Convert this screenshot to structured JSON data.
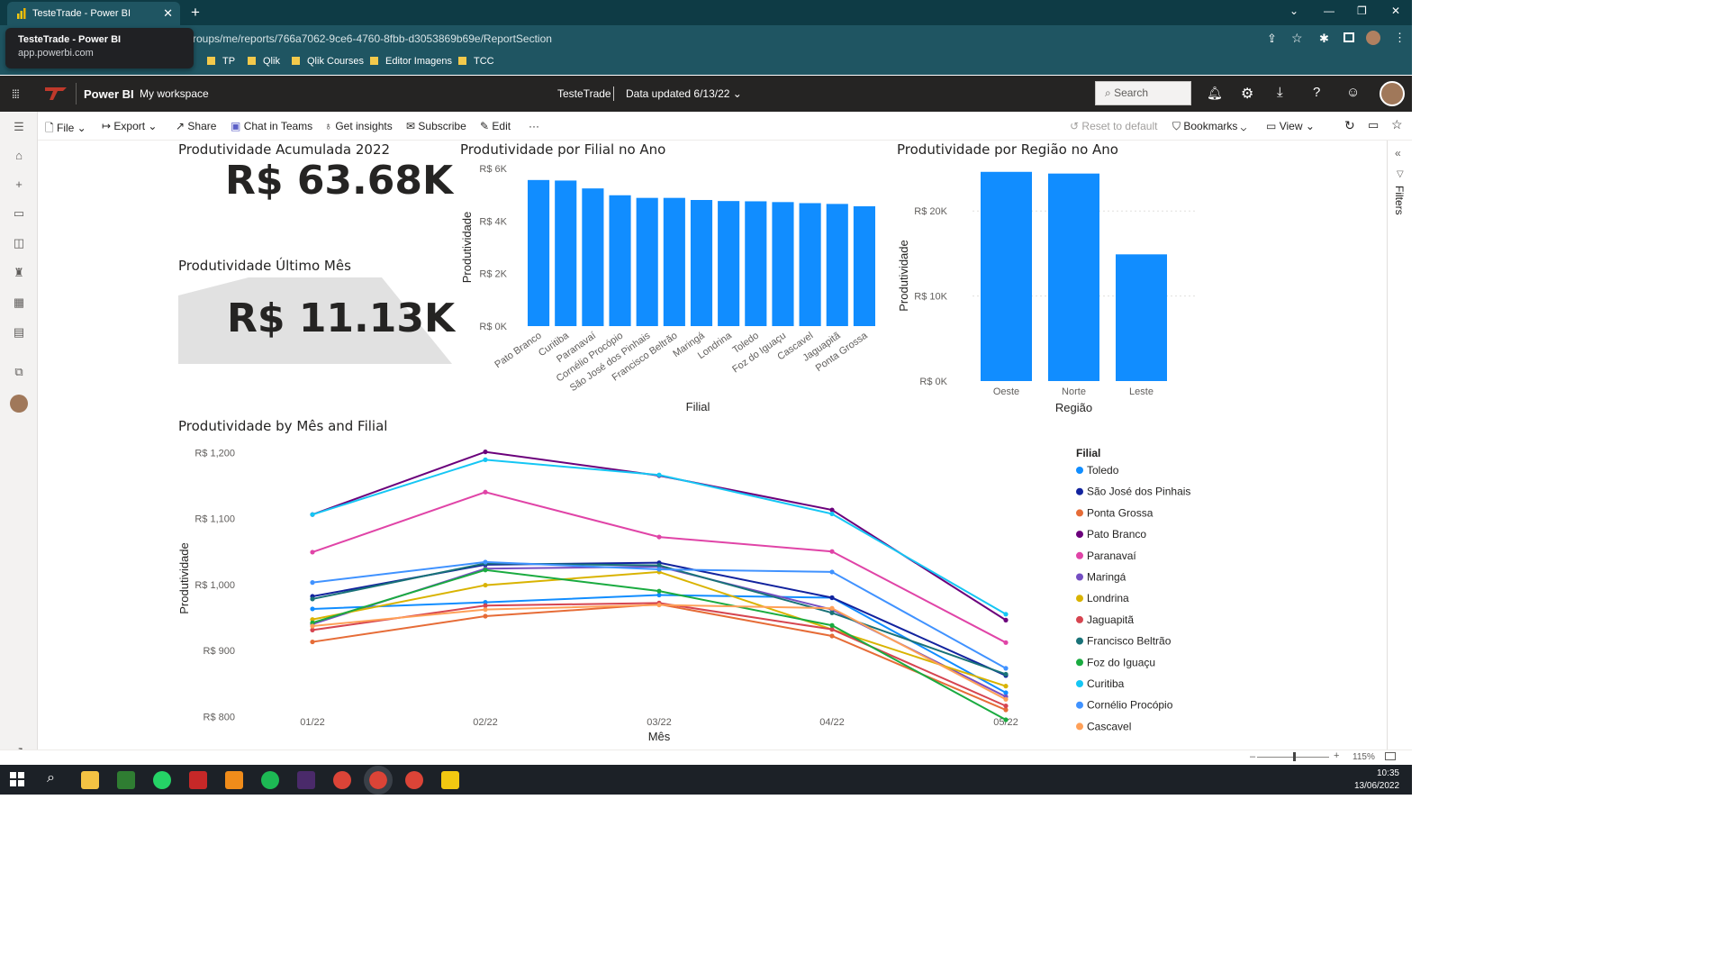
{
  "browser": {
    "tab_title": "TesteTrade - Power BI",
    "tooltip_title": "TesteTrade - Power BI",
    "tooltip_domain": "app.powerbi.com",
    "url": "roups/me/reports/766a7062-9ce6-4760-8fbb-d3053869b69e/ReportSection",
    "bookmarks": [
      "TP",
      "Qlik",
      "Qlik Courses",
      "Editor Imagens",
      "TCC"
    ]
  },
  "header": {
    "app": "Power BI",
    "workspace": "My workspace",
    "report": "TesteTrade",
    "data_updated": "Data updated 6/13/22",
    "search_placeholder": "Search"
  },
  "actions": {
    "file": "File",
    "export": "Export",
    "share": "Share",
    "teams": "Chat in Teams",
    "insights": "Get insights",
    "subscribe": "Subscribe",
    "edit": "Edit",
    "more": "···",
    "reset": "Reset to default",
    "bookmarks": "Bookmarks",
    "view": "View"
  },
  "filters_label": "Filters",
  "kpis": {
    "acc_title": "Produtividade Acumulada 2022",
    "acc_value": "R$ 63.68K",
    "last_title": "Produtividade Último Mês",
    "last_value": "R$ 11.13K"
  },
  "status": {
    "zoom": "115%"
  },
  "taskbar": {
    "time": "10:35",
    "date": "13/06/2022"
  },
  "chart_data": [
    {
      "type": "bar",
      "title": "Produtividade por Filial no Ano",
      "xlabel": "Filial",
      "ylabel": "Produtividade",
      "ylim": [
        0,
        6000
      ],
      "yticks": [
        "R$ 0K",
        "R$ 2K",
        "R$ 4K",
        "R$ 6K"
      ],
      "color": "#118DFF",
      "categories": [
        "Pato Branco",
        "Curitiba",
        "Paranavaí",
        "Cornélio Procópio",
        "São José dos Pinhais",
        "Francisco Beltrão",
        "Maringá",
        "Londrina",
        "Toledo",
        "Foz do Iguaçu",
        "Cascavel",
        "Jaguapitã",
        "Ponta Grossa"
      ],
      "values": [
        5560,
        5540,
        5240,
        4980,
        4880,
        4880,
        4800,
        4760,
        4750,
        4720,
        4680,
        4650,
        4560
      ]
    },
    {
      "type": "bar",
      "title": "Produtividade por Região no Ano",
      "xlabel": "Região",
      "ylabel": "Produtividade",
      "ylim": [
        0,
        25000
      ],
      "yticks": [
        "R$ 0K",
        "R$ 10K",
        "R$ 20K"
      ],
      "color": "#118DFF",
      "categories": [
        "Oeste",
        "Norte",
        "Leste"
      ],
      "values": [
        24600,
        24400,
        14900
      ]
    },
    {
      "type": "line",
      "title": "Produtividade by Mês and Filial",
      "xlabel": "Mês",
      "ylabel": "Produtividade",
      "ylim": [
        780,
        1210
      ],
      "yticks": [
        "R$ 800",
        "R$ 900",
        "R$ 1,000",
        "R$ 1,100",
        "R$ 1,200"
      ],
      "ytick_values": [
        800,
        900,
        1000,
        1100,
        1200
      ],
      "legend_title": "Filial",
      "categories": [
        "01/22",
        "02/22",
        "03/22",
        "04/22",
        "05/22"
      ],
      "series": [
        {
          "name": "Toledo",
          "color": "#118DFF",
          "values": [
            963,
            973,
            984,
            980,
            836
          ]
        },
        {
          "name": "São José dos Pinhais",
          "color": "#12239E",
          "values": [
            982,
            1030,
            1033,
            980,
            862
          ]
        },
        {
          "name": "Ponta Grossa",
          "color": "#E66C37",
          "values": [
            913,
            952,
            970,
            922,
            810
          ]
        },
        {
          "name": "Pato Branco",
          "color": "#6B007B",
          "values": [
            1106,
            1201,
            1165,
            1113,
            946
          ]
        },
        {
          "name": "Paranavaí",
          "color": "#E044A7",
          "values": [
            1049,
            1140,
            1072,
            1050,
            912
          ]
        },
        {
          "name": "Maringá",
          "color": "#744EC2",
          "values": [
            940,
            1024,
            1027,
            962,
            830
          ]
        },
        {
          "name": "Londrina",
          "color": "#D9B300",
          "values": [
            947,
            999,
            1019,
            932,
            846
          ]
        },
        {
          "name": "Jaguapitã",
          "color": "#D64550",
          "values": [
            931,
            968,
            972,
            932,
            816
          ]
        },
        {
          "name": "Francisco Beltrão",
          "color": "#197278",
          "values": [
            978,
            1032,
            1029,
            957,
            864
          ]
        },
        {
          "name": "Foz do Iguaçu",
          "color": "#1AAB40",
          "values": [
            942,
            1022,
            990,
            938,
            795
          ]
        },
        {
          "name": "Curitiba",
          "color": "#15C6F4",
          "values": [
            1106,
            1189,
            1166,
            1107,
            955
          ]
        },
        {
          "name": "Cornélio Procópio",
          "color": "#4092FF",
          "values": [
            1003,
            1034,
            1023,
            1019,
            873
          ]
        },
        {
          "name": "Cascavel",
          "color": "#FFA058",
          "values": [
            937,
            962,
            969,
            964,
            826
          ]
        }
      ]
    }
  ]
}
